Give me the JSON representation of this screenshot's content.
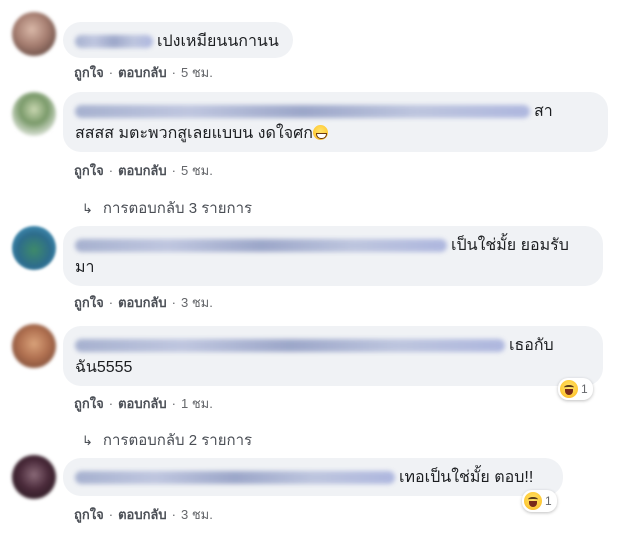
{
  "comments": [
    {
      "text": "เปงเหมียนนกานน",
      "actions": {
        "like": "ถูกใจ",
        "reply": "ตอบกลับ",
        "time": "5 ชม."
      }
    },
    {
      "text_line1": "สา",
      "text_line2": "สสสส มตะพวกสูเลยแบบน งดใจศก",
      "emoji": "grinning-face-icon",
      "actions": {
        "like": "ถูกใจ",
        "reply": "ตอบกลับ",
        "time": "5 ชม."
      },
      "replies_label": "การตอบกลับ 3 รายการ"
    },
    {
      "text_line1": "เป็นใช่มั้ย ยอมรับ",
      "text_line2": "มา",
      "actions": {
        "like": "ถูกใจ",
        "reply": "ตอบกลับ",
        "time": "3 ชม."
      }
    },
    {
      "text_line1": "เธอกับ",
      "text_line2": "ฉัน5555",
      "reaction": {
        "icon": "haha-reaction-icon",
        "count": "1"
      },
      "actions": {
        "like": "ถูกใจ",
        "reply": "ตอบกลับ",
        "time": "1 ชม."
      },
      "replies_label": "การตอบกลับ 2 รายการ"
    },
    {
      "text": "เทอเป็นใช่มั้ย ตอบ!!",
      "reaction": {
        "icon": "haha-reaction-icon",
        "count": "1"
      },
      "actions": {
        "like": "ถูกใจ",
        "reply": "ตอบกลับ",
        "time": "3 ชม."
      }
    }
  ],
  "colors": {
    "bubble": "#f0f2f5",
    "meta": "#65676b",
    "text": "#1c1e21"
  }
}
